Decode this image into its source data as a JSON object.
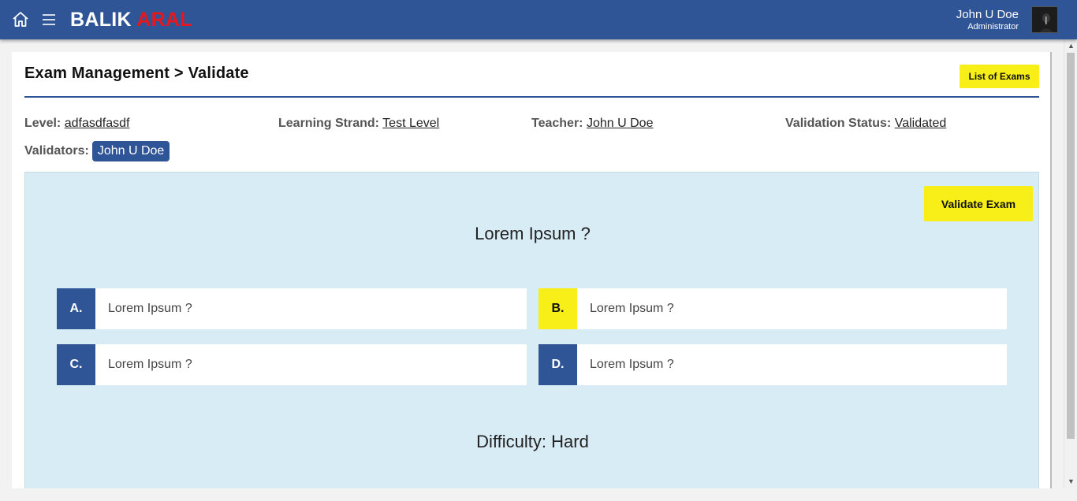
{
  "header": {
    "brand_part1": "BALIK",
    "brand_part2": "ARAL",
    "user_name": "John U Doe",
    "user_role": "Administrator",
    "icons": {
      "home": "home-icon",
      "menu": "hamburger-menu-icon"
    },
    "colors": {
      "bar": "#2f5597",
      "brand_accent": "#e8161d"
    }
  },
  "page": {
    "title": "Exam Management > Validate",
    "list_button": "List of Exams"
  },
  "meta": {
    "level_label": "Level:",
    "level_value": "adfasdfasdf",
    "strand_label": "Learning Strand:",
    "strand_value": "Test Level",
    "teacher_label": "Teacher:",
    "teacher_value": "John U Doe",
    "status_label": "Validation Status:",
    "status_value": "Validated",
    "validators_label": "Validators:",
    "validators": [
      "John U Doe"
    ]
  },
  "question_panel": {
    "validate_button": "Validate Exam",
    "question": "Lorem Ipsum ?",
    "options": [
      {
        "letter": "A.",
        "text": "Lorem Ipsum ?",
        "selected": false
      },
      {
        "letter": "B.",
        "text": "Lorem Ipsum ?",
        "selected": true
      },
      {
        "letter": "C.",
        "text": "Lorem Ipsum ?",
        "selected": false
      },
      {
        "letter": "D.",
        "text": "Lorem Ipsum ?",
        "selected": false
      }
    ],
    "difficulty": "Difficulty: Hard",
    "colors": {
      "panel_bg": "#d8ecf6",
      "highlight": "#f7ef17"
    }
  }
}
